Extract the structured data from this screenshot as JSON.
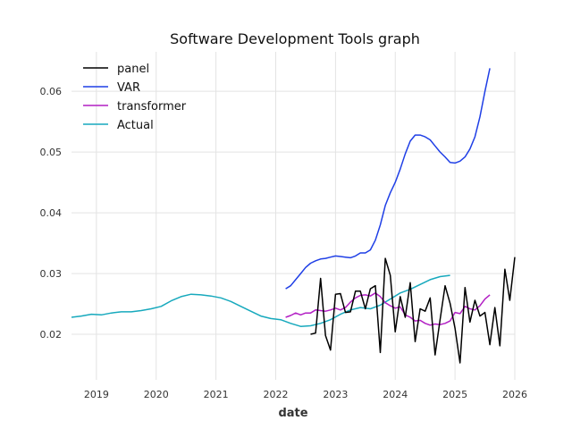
{
  "chart_data": {
    "type": "line",
    "title": "Software Development Tools graph",
    "xlabel": "date",
    "ylabel": "",
    "xlim": [
      "2018-08-01",
      "2026-01-01"
    ],
    "ylim": [
      0.0125,
      0.0665
    ],
    "x_ticks": [
      "2019",
      "2020",
      "2021",
      "2022",
      "2023",
      "2024",
      "2025",
      "2026"
    ],
    "y_ticks": [
      "0.02",
      "0.03",
      "0.04",
      "0.05",
      "0.06"
    ],
    "y_tick_values": [
      0.02,
      0.03,
      0.04,
      0.05,
      0.06
    ],
    "grid": true,
    "legend_position": "top-left",
    "series": [
      {
        "name": "panel",
        "color": "#000000",
        "points": [
          [
            "2022-08-01",
            0.02
          ],
          [
            "2022-09-01",
            0.0202
          ],
          [
            "2022-10-01",
            0.0292
          ],
          [
            "2022-11-01",
            0.0198
          ],
          [
            "2022-12-01",
            0.0174
          ],
          [
            "2023-01-01",
            0.0266
          ],
          [
            "2023-02-01",
            0.0267
          ],
          [
            "2023-03-01",
            0.0236
          ],
          [
            "2023-04-01",
            0.0237
          ],
          [
            "2023-05-01",
            0.0271
          ],
          [
            "2023-06-01",
            0.0271
          ],
          [
            "2023-07-01",
            0.0242
          ],
          [
            "2023-08-01",
            0.0275
          ],
          [
            "2023-09-01",
            0.028
          ],
          [
            "2023-10-01",
            0.017
          ],
          [
            "2023-11-01",
            0.0325
          ],
          [
            "2023-12-01",
            0.0297
          ],
          [
            "2024-01-01",
            0.0204
          ],
          [
            "2024-02-01",
            0.0262
          ],
          [
            "2024-03-01",
            0.0228
          ],
          [
            "2024-04-01",
            0.0285
          ],
          [
            "2024-05-01",
            0.0188
          ],
          [
            "2024-06-01",
            0.0242
          ],
          [
            "2024-07-01",
            0.0238
          ],
          [
            "2024-08-01",
            0.026
          ],
          [
            "2024-09-01",
            0.0166
          ],
          [
            "2024-10-01",
            0.0224
          ],
          [
            "2024-11-01",
            0.028
          ],
          [
            "2024-12-01",
            0.0251
          ],
          [
            "2025-01-01",
            0.021
          ],
          [
            "2025-02-01",
            0.0153
          ],
          [
            "2025-03-01",
            0.0277
          ],
          [
            "2025-04-01",
            0.022
          ],
          [
            "2025-05-01",
            0.0256
          ],
          [
            "2025-06-01",
            0.023
          ],
          [
            "2025-07-01",
            0.0236
          ],
          [
            "2025-08-01",
            0.0183
          ],
          [
            "2025-09-01",
            0.0244
          ],
          [
            "2025-10-01",
            0.0181
          ],
          [
            "2025-11-01",
            0.0307
          ],
          [
            "2025-12-01",
            0.0256
          ],
          [
            "2026-01-01",
            0.0327
          ]
        ]
      },
      {
        "name": "VAR",
        "color": "#1f3fe6",
        "points": [
          [
            "2022-03-01",
            0.0275
          ],
          [
            "2022-04-01",
            0.028
          ],
          [
            "2022-05-01",
            0.029
          ],
          [
            "2022-06-01",
            0.03
          ],
          [
            "2022-07-01",
            0.031
          ],
          [
            "2022-08-01",
            0.0317
          ],
          [
            "2022-09-01",
            0.0321
          ],
          [
            "2022-10-01",
            0.0324
          ],
          [
            "2022-11-01",
            0.0325
          ],
          [
            "2022-12-01",
            0.0327
          ],
          [
            "2023-01-01",
            0.0329
          ],
          [
            "2023-02-01",
            0.0328
          ],
          [
            "2023-03-01",
            0.0327
          ],
          [
            "2023-04-01",
            0.0326
          ],
          [
            "2023-05-01",
            0.0329
          ],
          [
            "2023-06-01",
            0.0334
          ],
          [
            "2023-07-01",
            0.0334
          ],
          [
            "2023-08-01",
            0.0339
          ],
          [
            "2023-09-01",
            0.0355
          ],
          [
            "2023-10-01",
            0.038
          ],
          [
            "2023-11-01",
            0.0412
          ],
          [
            "2023-12-01",
            0.0433
          ],
          [
            "2024-01-01",
            0.045
          ],
          [
            "2024-02-01",
            0.0472
          ],
          [
            "2024-03-01",
            0.0497
          ],
          [
            "2024-04-01",
            0.0518
          ],
          [
            "2024-05-01",
            0.0528
          ],
          [
            "2024-06-01",
            0.0528
          ],
          [
            "2024-07-01",
            0.0525
          ],
          [
            "2024-08-01",
            0.052
          ],
          [
            "2024-09-01",
            0.051
          ],
          [
            "2024-10-01",
            0.05
          ],
          [
            "2024-11-01",
            0.0492
          ],
          [
            "2024-12-01",
            0.0483
          ],
          [
            "2025-01-01",
            0.0482
          ],
          [
            "2025-02-01",
            0.0485
          ],
          [
            "2025-03-01",
            0.0492
          ],
          [
            "2025-04-01",
            0.0505
          ],
          [
            "2025-05-01",
            0.0525
          ],
          [
            "2025-06-01",
            0.0558
          ],
          [
            "2025-07-01",
            0.06
          ],
          [
            "2025-08-01",
            0.0638
          ]
        ]
      },
      {
        "name": "transformer",
        "color": "#b21fc4",
        "points": [
          [
            "2022-03-01",
            0.0228
          ],
          [
            "2022-04-01",
            0.0231
          ],
          [
            "2022-05-01",
            0.0235
          ],
          [
            "2022-06-01",
            0.0232
          ],
          [
            "2022-07-01",
            0.0235
          ],
          [
            "2022-08-01",
            0.0235
          ],
          [
            "2022-09-01",
            0.024
          ],
          [
            "2022-10-01",
            0.0239
          ],
          [
            "2022-11-01",
            0.0238
          ],
          [
            "2022-12-01",
            0.024
          ],
          [
            "2023-01-01",
            0.0243
          ],
          [
            "2023-02-01",
            0.024
          ],
          [
            "2023-03-01",
            0.0244
          ],
          [
            "2023-04-01",
            0.0253
          ],
          [
            "2023-05-01",
            0.026
          ],
          [
            "2023-06-01",
            0.0264
          ],
          [
            "2023-07-01",
            0.0265
          ],
          [
            "2023-08-01",
            0.0263
          ],
          [
            "2023-09-01",
            0.0268
          ],
          [
            "2023-10-01",
            0.0262
          ],
          [
            "2023-11-01",
            0.0252
          ],
          [
            "2023-12-01",
            0.0247
          ],
          [
            "2024-01-01",
            0.0243
          ],
          [
            "2024-02-01",
            0.0245
          ],
          [
            "2024-03-01",
            0.0232
          ],
          [
            "2024-04-01",
            0.0228
          ],
          [
            "2024-05-01",
            0.0222
          ],
          [
            "2024-06-01",
            0.0223
          ],
          [
            "2024-07-01",
            0.0218
          ],
          [
            "2024-08-01",
            0.0215
          ],
          [
            "2024-09-01",
            0.0217
          ],
          [
            "2024-10-01",
            0.0216
          ],
          [
            "2024-11-01",
            0.0218
          ],
          [
            "2024-12-01",
            0.0222
          ],
          [
            "2025-01-01",
            0.0236
          ],
          [
            "2025-02-01",
            0.0234
          ],
          [
            "2025-03-01",
            0.0246
          ],
          [
            "2025-04-01",
            0.0242
          ],
          [
            "2025-05-01",
            0.024
          ],
          [
            "2025-06-01",
            0.0247
          ],
          [
            "2025-07-01",
            0.0258
          ],
          [
            "2025-08-01",
            0.0265
          ]
        ]
      },
      {
        "name": "Actual",
        "color": "#17a9bd",
        "points": [
          [
            "2018-08-01",
            0.0228
          ],
          [
            "2018-10-01",
            0.023
          ],
          [
            "2018-12-01",
            0.0233
          ],
          [
            "2019-02-01",
            0.0232
          ],
          [
            "2019-04-01",
            0.0235
          ],
          [
            "2019-06-01",
            0.0237
          ],
          [
            "2019-08-01",
            0.0237
          ],
          [
            "2019-10-01",
            0.0239
          ],
          [
            "2019-12-01",
            0.0242
          ],
          [
            "2020-02-01",
            0.0246
          ],
          [
            "2020-04-01",
            0.0255
          ],
          [
            "2020-06-01",
            0.0262
          ],
          [
            "2020-08-01",
            0.0266
          ],
          [
            "2020-10-01",
            0.0265
          ],
          [
            "2020-12-01",
            0.0263
          ],
          [
            "2021-02-01",
            0.026
          ],
          [
            "2021-04-01",
            0.0254
          ],
          [
            "2021-06-01",
            0.0246
          ],
          [
            "2021-08-01",
            0.0238
          ],
          [
            "2021-10-01",
            0.023
          ],
          [
            "2021-12-01",
            0.0226
          ],
          [
            "2022-02-01",
            0.0224
          ],
          [
            "2022-04-01",
            0.0218
          ],
          [
            "2022-06-01",
            0.0213
          ],
          [
            "2022-08-01",
            0.0214
          ],
          [
            "2022-10-01",
            0.0218
          ],
          [
            "2022-12-01",
            0.0224
          ],
          [
            "2023-02-01",
            0.0233
          ],
          [
            "2023-04-01",
            0.024
          ],
          [
            "2023-06-01",
            0.0244
          ],
          [
            "2023-08-01",
            0.0242
          ],
          [
            "2023-10-01",
            0.0248
          ],
          [
            "2023-12-01",
            0.0258
          ],
          [
            "2024-02-01",
            0.0268
          ],
          [
            "2024-04-01",
            0.0274
          ],
          [
            "2024-06-01",
            0.0282
          ],
          [
            "2024-08-01",
            0.029
          ],
          [
            "2024-10-01",
            0.0295
          ],
          [
            "2024-12-01",
            0.0297
          ]
        ]
      }
    ]
  }
}
